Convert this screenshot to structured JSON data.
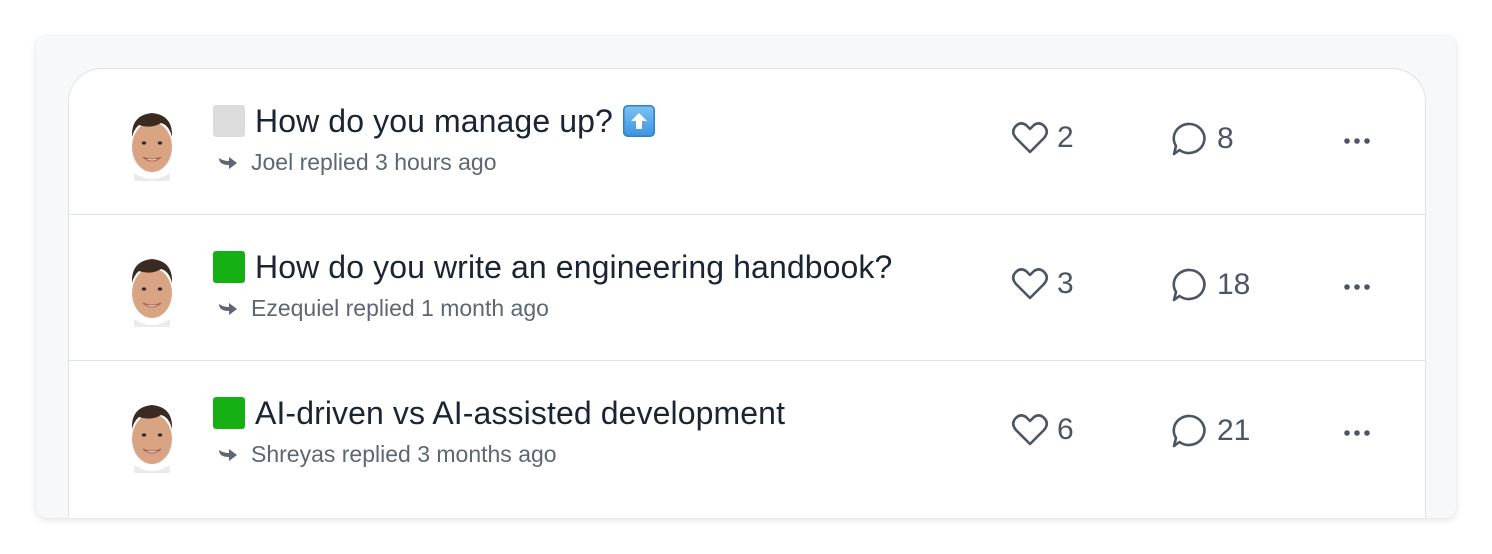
{
  "threads": [
    {
      "status_color": "#dcdcdc",
      "title": "How do you manage up?",
      "title_emoji": "up-arrow-emoji",
      "reply_text": "Joel replied 3 hours ago",
      "likes": "2",
      "comments": "8"
    },
    {
      "status_color": "#16b014",
      "title": "How do you write an engineering handbook?",
      "title_emoji": "",
      "reply_text": "Ezequiel replied 1 month ago",
      "likes": "3",
      "comments": "18"
    },
    {
      "status_color": "#16b014",
      "title": "AI-driven vs AI-assisted development",
      "title_emoji": "",
      "reply_text": "Shreyas replied 3 months ago",
      "likes": "6",
      "comments": "21"
    }
  ],
  "icons": {
    "like": "heart-icon",
    "comment": "speech-bubble-icon",
    "reply": "reply-arrow-icon",
    "more": "more-dots-icon"
  },
  "colors": {
    "title": "#1b2433",
    "meta": "#5d6675",
    "divider": "#dfe2e7"
  }
}
